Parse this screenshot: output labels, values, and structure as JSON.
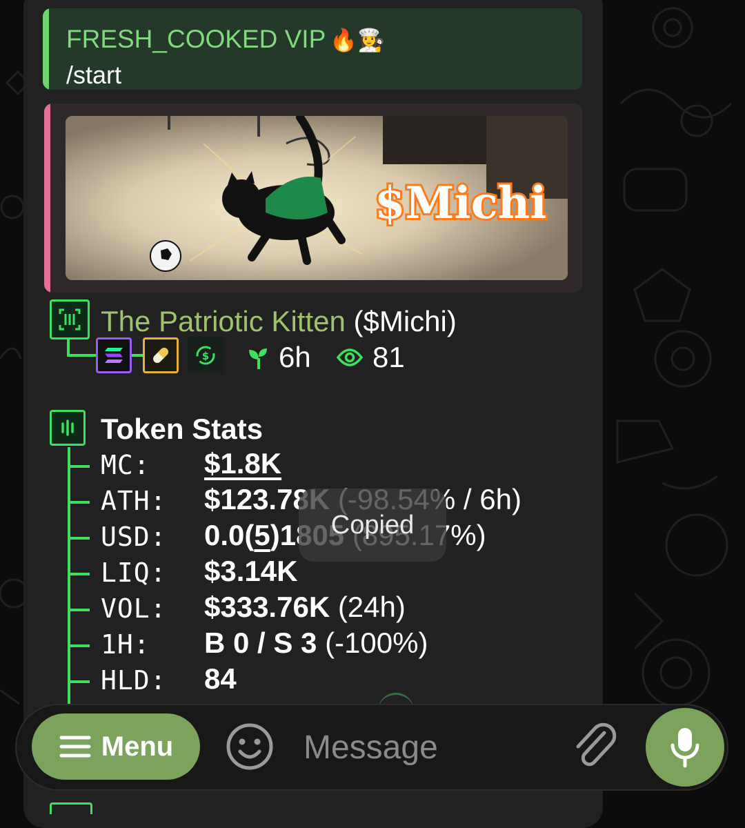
{
  "reply": {
    "sender": "FRESH_COOKED VIP",
    "sender_emojis": "🔥👩‍🍳",
    "text": "/start"
  },
  "preview": {
    "image_text": "$Michi",
    "bar_color": "#e26f94"
  },
  "token": {
    "name": "The Patriotic Kitten",
    "ticker": "($Michi)",
    "age": "6h",
    "views": "81",
    "badges": [
      "solana-icon",
      "pill-icon",
      "swap-icon"
    ]
  },
  "stats": {
    "title": "Token Stats",
    "rows": [
      {
        "label": "MC:",
        "value": "$1.8K",
        "extra": ""
      },
      {
        "label": "ATH:",
        "value": "$123.78K",
        "extra": " (-98.54% / 6h)"
      },
      {
        "label": "USD:",
        "value_pre": "0.0(",
        "value_sub": "5",
        "value_post": ")18",
        "value_hidden": "05",
        "extra": " (895.17%)"
      },
      {
        "label": "LIQ:",
        "value": "$3.14K",
        "extra": ""
      },
      {
        "label": "VOL:",
        "value": "$333.76K",
        "extra": " (24h)"
      },
      {
        "label": "1H:",
        "value": "B 0 / S 3",
        "extra": " (-100%)"
      },
      {
        "label": "HLD:",
        "value": "84",
        "extra": ""
      }
    ]
  },
  "toast": {
    "text": "Copied"
  },
  "input_bar": {
    "menu_label": "Menu",
    "placeholder": "Message"
  },
  "colors": {
    "accent_green": "#7ba35c",
    "tree_green": "#3ee05f",
    "bubble": "#212121",
    "token_name": "#9fc26e"
  }
}
